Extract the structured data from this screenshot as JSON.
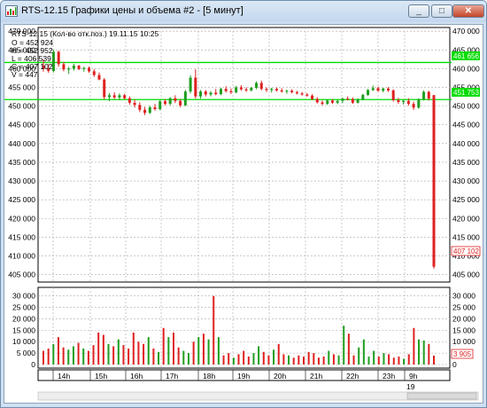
{
  "window": {
    "title": "RTS-12.15 Графики цены и объема #2 - [5 минут]",
    "minimize_glyph": "_",
    "maximize_glyph": "□",
    "close_glyph": "✕"
  },
  "info": {
    "header": "RTS-12.15 (Кол-во отк.поз.) 19.11.15 10:25",
    "open": "O = 452 924",
    "high": "H = 452 952",
    "low": "L = 406 539",
    "close": "C = 407 102",
    "volume": "V = 447"
  },
  "colors": {
    "up": "#1f9e1f",
    "down": "#e02020",
    "level": "#00dd00",
    "grid": "#a9a9a9"
  },
  "price_axis": {
    "labels": [
      "470 000",
      "465 000",
      "460 000",
      "455 000",
      "450 000",
      "445 000",
      "440 000",
      "435 000",
      "430 000",
      "425 000",
      "420 000",
      "415 000",
      "410 000",
      "405 000"
    ],
    "level_high": "461 656",
    "level_low": "451 753",
    "last_price": "407 102"
  },
  "volume_axis": {
    "labels": [
      "30 000",
      "25 000",
      "20 000",
      "15 000",
      "10 000",
      "5 000",
      "0"
    ],
    "last_volume": "3 905"
  },
  "time_axis": {
    "labels": [
      "14h",
      "15h",
      "16h",
      "17h",
      "18h",
      "19h",
      "20h",
      "21h",
      "22h",
      "23h",
      "9h"
    ],
    "day_label": "19"
  },
  "chart_data": {
    "type": "candlestick",
    "y_range": [
      403000,
      471000
    ],
    "volume_range": [
      0,
      33000
    ],
    "levels": [
      461656,
      451753
    ],
    "candles": [
      [
        460800,
        462500,
        459200,
        460000
      ],
      [
        460000,
        461200,
        458900,
        459400
      ],
      [
        459400,
        465000,
        459000,
        464500
      ],
      [
        464500,
        464800,
        460500,
        461200
      ],
      [
        461200,
        461800,
        459300,
        459800
      ],
      [
        459800,
        460500,
        458600,
        460000
      ],
      [
        460000,
        461300,
        459500,
        460800
      ],
      [
        460800,
        461000,
        459600,
        459900
      ],
      [
        459900,
        460500,
        459200,
        460200
      ],
      [
        460200,
        460600,
        458900,
        459300
      ],
      [
        459300,
        459900,
        457800,
        458300
      ],
      [
        458300,
        459000,
        456900,
        457100
      ],
      [
        457100,
        457500,
        451800,
        452400
      ],
      [
        452400,
        453500,
        451300,
        452900
      ],
      [
        452900,
        453700,
        451900,
        452300
      ],
      [
        452300,
        453400,
        451600,
        452900
      ],
      [
        452900,
        453300,
        451800,
        452100
      ],
      [
        452100,
        452600,
        450400,
        450900
      ],
      [
        450900,
        451800,
        449600,
        450300
      ],
      [
        450300,
        451000,
        448400,
        449000
      ],
      [
        449000,
        449800,
        447600,
        448200
      ],
      [
        448200,
        450100,
        447900,
        449700
      ],
      [
        449700,
        450600,
        448800,
        449200
      ],
      [
        449200,
        451600,
        448900,
        451300
      ],
      [
        451300,
        451900,
        450200,
        450600
      ],
      [
        450600,
        452400,
        450200,
        452100
      ],
      [
        452100,
        452900,
        450800,
        451400
      ],
      [
        451400,
        451900,
        449700,
        450200
      ],
      [
        450200,
        454300,
        450000,
        453900
      ],
      [
        453900,
        458200,
        453400,
        457600
      ],
      [
        457600,
        459800,
        452000,
        452600
      ],
      [
        452600,
        454300,
        452000,
        453900
      ],
      [
        453900,
        454300,
        452600,
        453100
      ],
      [
        453100,
        454000,
        452600,
        453600
      ],
      [
        453600,
        454600,
        452900,
        453200
      ],
      [
        453200,
        454900,
        452900,
        454600
      ],
      [
        454600,
        455300,
        453600,
        454000
      ],
      [
        454000,
        454700,
        453200,
        453700
      ],
      [
        453700,
        455400,
        453400,
        455000
      ],
      [
        455000,
        455600,
        454100,
        454500
      ],
      [
        454500,
        455000,
        453800,
        454200
      ],
      [
        454200,
        455100,
        453900,
        454900
      ],
      [
        454900,
        456600,
        454500,
        456200
      ],
      [
        456200,
        456800,
        454200,
        454600
      ],
      [
        454600,
        455000,
        453800,
        454300
      ],
      [
        454300,
        454900,
        453600,
        454600
      ],
      [
        454600,
        455000,
        453900,
        454200
      ],
      [
        454200,
        454800,
        453600,
        453900
      ],
      [
        453900,
        454400,
        453300,
        454100
      ],
      [
        454100,
        454500,
        453400,
        453700
      ],
      [
        453700,
        454100,
        453100,
        453400
      ],
      [
        453400,
        453800,
        452800,
        453100
      ],
      [
        453100,
        453500,
        452500,
        452800
      ],
      [
        452800,
        453200,
        451600,
        451900
      ],
      [
        451900,
        452400,
        450700,
        451000
      ],
      [
        451000,
        451500,
        450200,
        450600
      ],
      [
        450600,
        451800,
        450300,
        451500
      ],
      [
        451500,
        451900,
        450600,
        450900
      ],
      [
        450900,
        451700,
        450500,
        451400
      ],
      [
        451400,
        452300,
        450800,
        452000
      ],
      [
        452000,
        452600,
        451500,
        451900
      ],
      [
        451900,
        452300,
        450600,
        450900
      ],
      [
        450900,
        452100,
        450700,
        451800
      ],
      [
        451800,
        453300,
        451500,
        453000
      ],
      [
        453000,
        454600,
        452700,
        454300
      ],
      [
        454300,
        455500,
        454000,
        454800
      ],
      [
        454800,
        455200,
        453900,
        454100
      ],
      [
        454100,
        454900,
        453700,
        454700
      ],
      [
        454700,
        455100,
        453800,
        454200
      ],
      [
        454200,
        454500,
        451200,
        451600
      ],
      [
        451600,
        452200,
        450600,
        451100
      ],
      [
        451100,
        451700,
        450400,
        451400
      ],
      [
        451400,
        452100,
        450100,
        450600
      ],
      [
        450600,
        451200,
        449000,
        449600
      ],
      [
        449600,
        452100,
        449300,
        451800
      ],
      [
        451800,
        454200,
        451500,
        453800
      ],
      [
        453800,
        454100,
        451500,
        452000
      ],
      [
        452924,
        452952,
        406539,
        407102
      ]
    ],
    "volumes": [
      6000,
      7000,
      9000,
      12000,
      7500,
      6500,
      8000,
      9500,
      7000,
      6000,
      8500,
      14000,
      13000,
      9000,
      8000,
      11000,
      8500,
      7000,
      14000,
      10000,
      9000,
      12000,
      7000,
      5500,
      16000,
      12000,
      14000,
      7500,
      6000,
      5000,
      10000,
      12000,
      13500,
      11000,
      30000,
      12000,
      4000,
      5000,
      3000,
      4500,
      6000,
      3500,
      5000,
      8000,
      5500,
      4000,
      6500,
      9000,
      4500,
      4000,
      3000,
      4000,
      3500,
      5500,
      5000,
      3000,
      3500,
      6000,
      4500,
      4000,
      17000,
      13500,
      4000,
      7500,
      11000,
      3500,
      6000,
      3500,
      5000,
      4500,
      3000,
      3500,
      2500,
      4500,
      16000,
      11000,
      10500,
      9000,
      3905
    ]
  }
}
